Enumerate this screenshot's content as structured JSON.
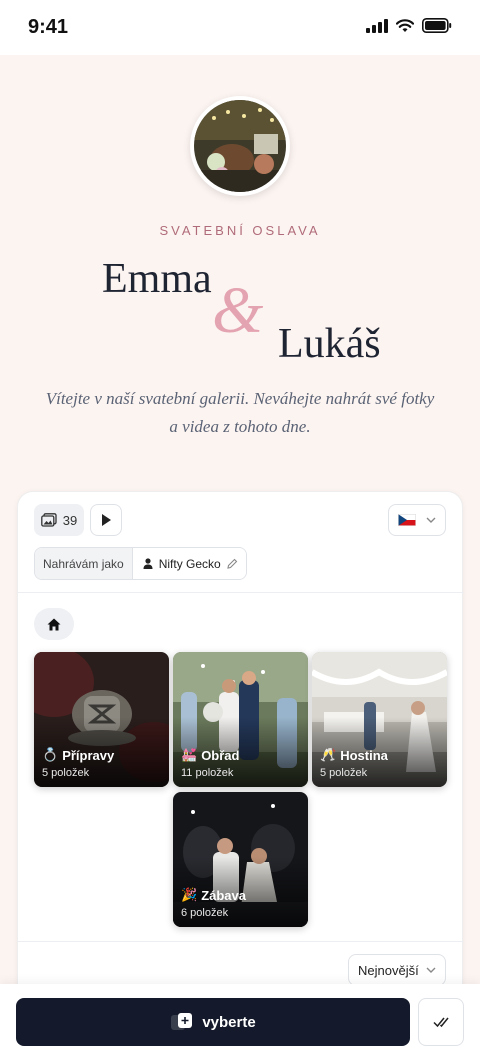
{
  "status_bar": {
    "time": "9:41"
  },
  "hero": {
    "eyebrow": "SVATEBNÍ OSLAVA",
    "name_first": "Emma",
    "ampersand": "&",
    "name_second": "Lukáš",
    "welcome": "Vítejte v naší svatební galerii. Neváhejte nahrát své fotky a videa z tohoto dne."
  },
  "toolbar": {
    "media_count": "39",
    "language": "cz-flag"
  },
  "uploader": {
    "label": "Nahrávám jako",
    "name": "Nifty Gecko"
  },
  "albums": [
    {
      "emoji": "💍",
      "title": "Přípravy",
      "count": "5 položek"
    },
    {
      "emoji": "💒",
      "title": "Obřad",
      "count": "11 položek"
    },
    {
      "emoji": "🥂",
      "title": "Hostina",
      "count": "5 položek"
    },
    {
      "emoji": "🎉",
      "title": "Zábava",
      "count": "6 položek"
    }
  ],
  "sort": {
    "selected": "Nejnovější"
  },
  "bottom": {
    "pick_label": "vyberte"
  },
  "colors": {
    "accent": "#e4a3b1",
    "eyebrow": "#b06b7a",
    "primary_button": "#141a2b",
    "background": "#fcf4f0"
  }
}
